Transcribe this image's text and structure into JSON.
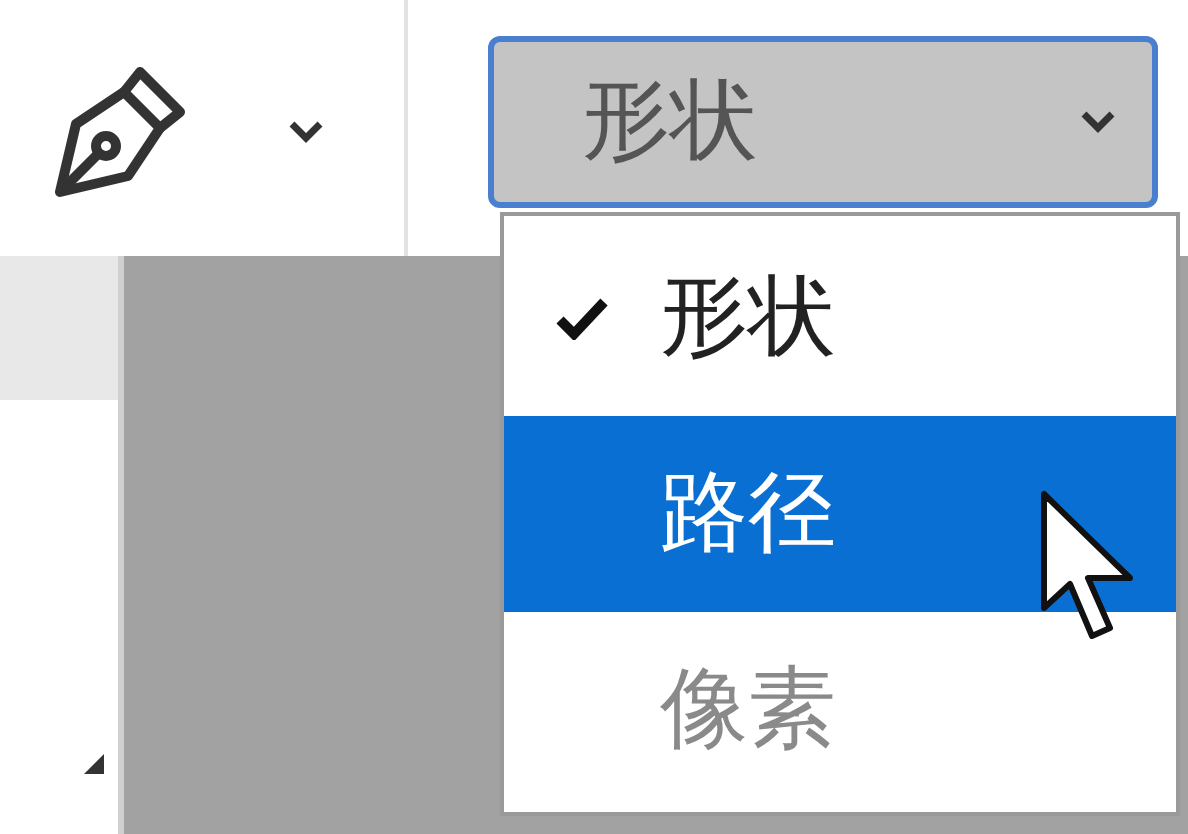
{
  "mode_dropdown": {
    "value": "形状",
    "open": true
  },
  "menu": {
    "items": [
      {
        "label": "形状",
        "checked": true,
        "selected": false,
        "disabled": false
      },
      {
        "label": "路径",
        "checked": false,
        "selected": true,
        "disabled": false
      },
      {
        "label": "像素",
        "checked": false,
        "selected": false,
        "disabled": true
      }
    ]
  }
}
